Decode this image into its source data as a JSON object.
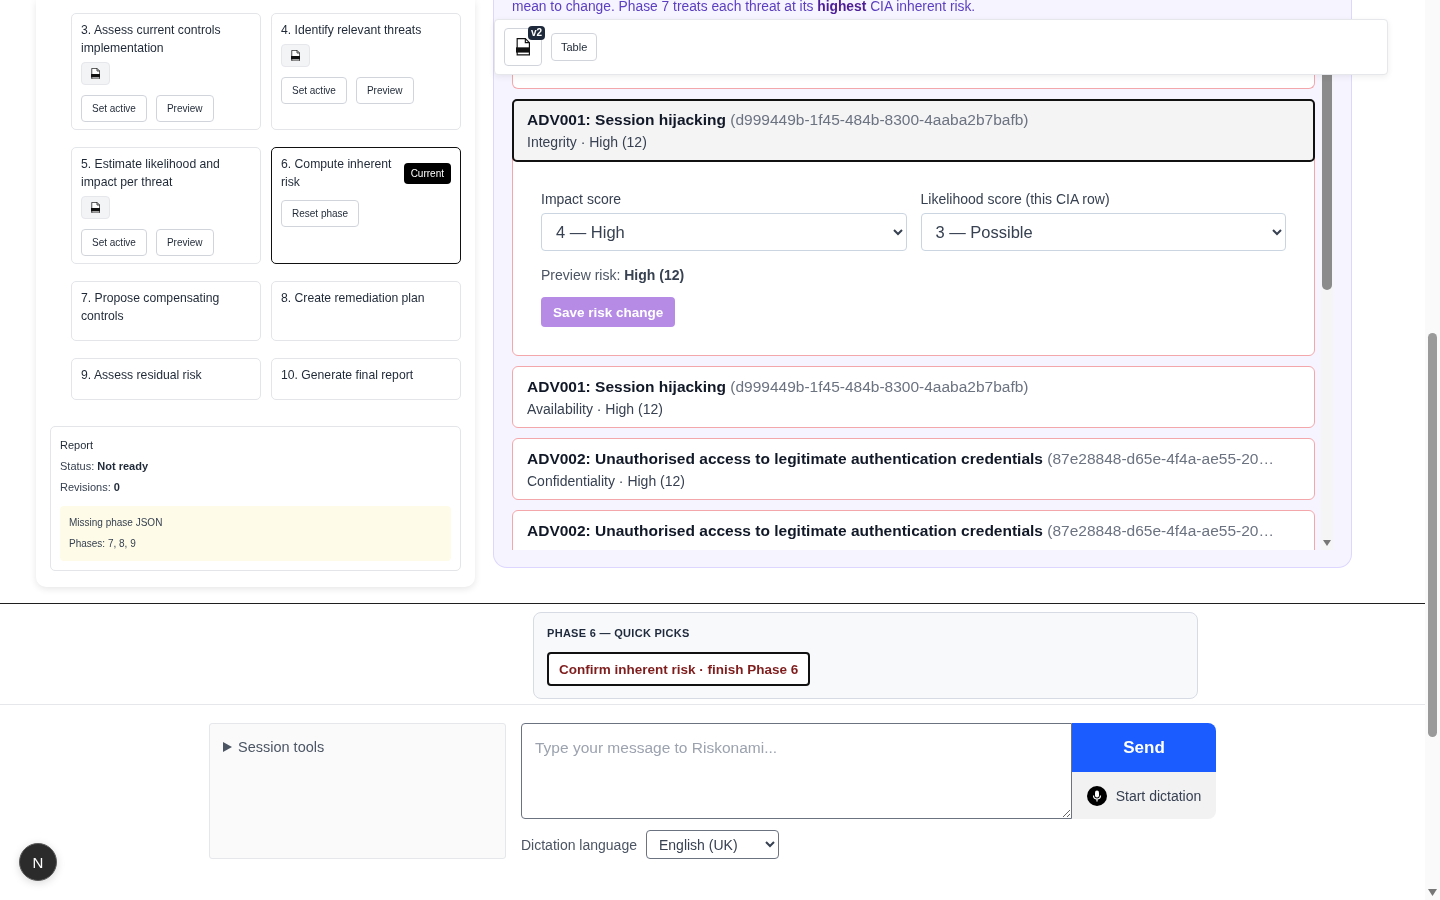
{
  "phase_board": {
    "phases": [
      {
        "title": "3. Assess current controls implementation",
        "current": false,
        "has_json": true,
        "buttons": [
          "Set active",
          "Preview"
        ]
      },
      {
        "title": "4. Identify relevant threats",
        "current": false,
        "has_json": true,
        "buttons": [
          "Set active",
          "Preview"
        ]
      },
      {
        "title": "5. Estimate likelihood and impact per threat",
        "current": false,
        "has_json": true,
        "buttons": [
          "Set active",
          "Preview"
        ]
      },
      {
        "title": "6. Compute inherent risk",
        "current": true,
        "badge": "Current",
        "has_json": false,
        "buttons": [
          "Reset phase"
        ]
      },
      {
        "title": "7. Propose compensating controls",
        "current": false,
        "has_json": false
      },
      {
        "title": "8. Create remediation plan",
        "current": false,
        "has_json": false
      },
      {
        "title": "9. Assess residual risk",
        "current": false,
        "has_json": false
      },
      {
        "title": "10. Generate final report",
        "current": false,
        "has_json": false
      }
    ],
    "report": {
      "title": "Report",
      "lines": [
        "Status: **Not ready**",
        "Revisions: **0**"
      ],
      "notice": {
        "title": "Missing phase JSON",
        "detail": "Phases: 7, 8, 9"
      }
    }
  },
  "risk_panel": {
    "note": "mean to change. Phase 7 treats each threat at its **highest** CIA inherent risk.",
    "toolbar": {
      "version_badge": "v2",
      "buttons": [
        "Table"
      ]
    },
    "threats": [
      {
        "title": "ADV001: Session hijacking",
        "id": "(d999449b-1f45-484b-8300-4aaba2b7bafb)",
        "detail": "Integrity · High (12)",
        "selected": true,
        "editor": {
          "impact_label": "Impact score",
          "impact_value": "4 — High",
          "likelihood_label": "Likelihood score (this CIA row)",
          "likelihood_value": "3 — Possible",
          "preview": "Preview risk: **High (12)**",
          "save_button": "Save risk change",
          "save_disabled": true
        }
      },
      {
        "title": "ADV001: Session hijacking",
        "id": "(d999449b-1f45-484b-8300-4aaba2b7bafb)",
        "detail": "Availability · High (12)",
        "selected": false
      },
      {
        "title": "ADV002: Unauthorised access to legitimate authentication credentials",
        "id": "(87e28848-d65e-4f4a-ae55-20…",
        "detail": "Confidentiality · High (12)",
        "selected": false
      },
      {
        "title": "ADV002: Unauthorised access to legitimate authentication credentials",
        "id": "(87e28848-d65e-4f4a-ae55-20…",
        "selected": false
      }
    ]
  },
  "quick_picks": {
    "title": "PHASE 6 — QUICK PICKS",
    "buttons": [
      "Confirm inherent risk · finish Phase 6"
    ]
  },
  "composer": {
    "session_tools": {
      "label": "Session tools",
      "expanded": false
    },
    "message": {
      "placeholder": "Type your message to Riskonami..."
    },
    "send_button": "Send",
    "dictation_button": "Start dictation",
    "language": {
      "label": "Dictation language",
      "value": "English (UK)"
    }
  },
  "dev_badge": {
    "label": "N"
  }
}
